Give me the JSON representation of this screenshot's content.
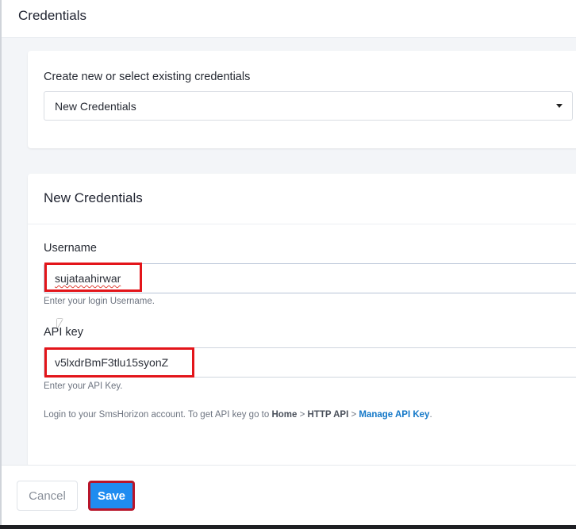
{
  "modal": {
    "title": "Credentials"
  },
  "credentials_selector": {
    "label": "Create new or select existing credentials",
    "selected": "New Credentials"
  },
  "new_credentials": {
    "title": "New Credentials",
    "username": {
      "label": "Username",
      "value": "sujataahirwar",
      "hint": "Enter your login Username."
    },
    "api_key": {
      "label": "API key",
      "value": "v5lxdrBmF3tlu15syonZ",
      "hint": "Enter your API Key."
    },
    "info": {
      "prefix": "Login to your SmsHorizon account. To get API key go to ",
      "path1": "Home",
      "sep1": " > ",
      "path2": "HTTP API",
      "sep2": " > ",
      "link": "Manage API Key",
      "suffix": "."
    }
  },
  "footer": {
    "cancel_label": "Cancel",
    "save_label": "Save"
  },
  "colors": {
    "primary": "#1f8cf0",
    "highlight": "#e3151a",
    "link": "#1478c8"
  }
}
